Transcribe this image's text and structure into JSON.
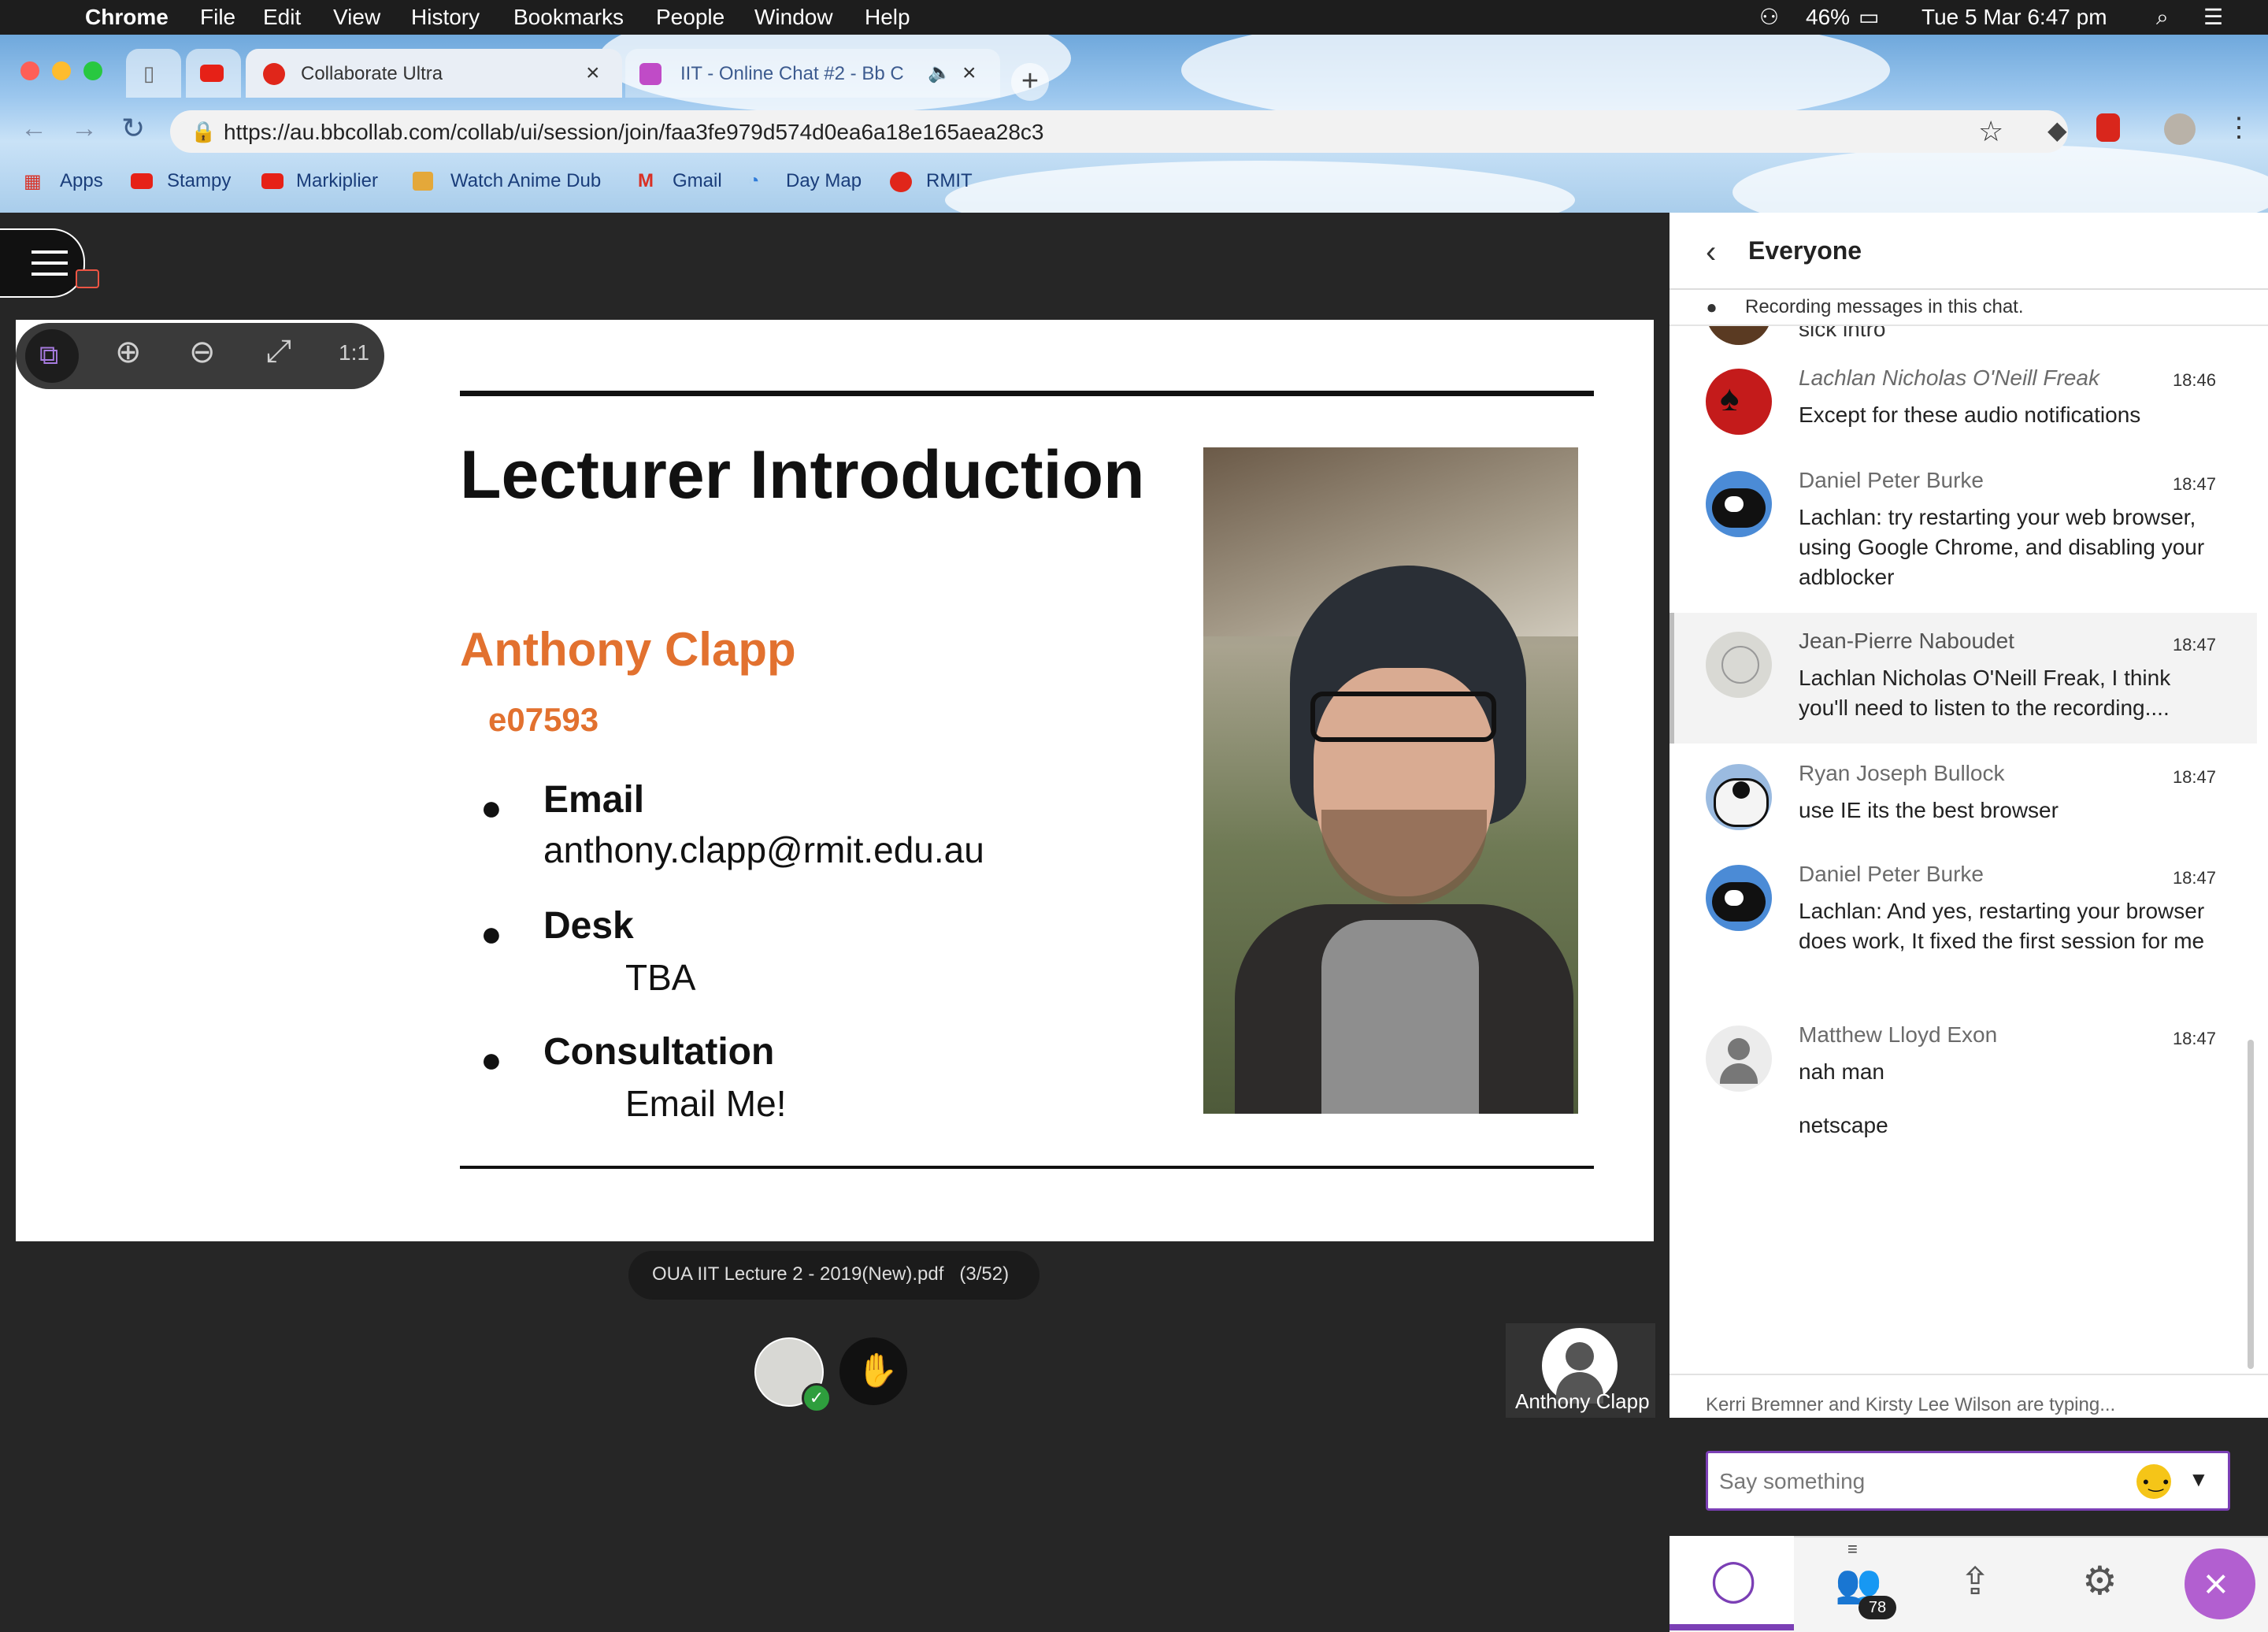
{
  "menubar": {
    "app": "Chrome",
    "items": [
      "File",
      "Edit",
      "View",
      "History",
      "Bookmarks",
      "People",
      "Window",
      "Help"
    ],
    "battery": "46%",
    "clock": "Tue 5 Mar  6:47 pm"
  },
  "browser": {
    "tabs": [
      {
        "title": "Collaborate Ultra",
        "active": true
      },
      {
        "title": "IIT - Online Chat #2 - Bb C",
        "active": false
      }
    ],
    "url": "https://au.bbcollab.com/collab/ui/session/join/faa3fe979d574d0ea6a18e165aea28c3",
    "url_host": "au.bbcollab.com",
    "bookmarks": [
      "Apps",
      "Stampy",
      "Markiplier",
      "Watch Anime Dub",
      "Gmail",
      "Day Map",
      "RMIT"
    ]
  },
  "slide": {
    "title": "Lecturer Introduction",
    "name": "Anthony Clapp",
    "id": "e07593",
    "items": [
      {
        "label": "Email",
        "value": "anthony.clapp@rmit.edu.au"
      },
      {
        "label": "Desk",
        "value": "TBA"
      },
      {
        "label": "Consultation",
        "value": "Email Me!"
      }
    ],
    "file_label": "OUA IIT Lecture 2 - 2019(New).pdf   (3/52)"
  },
  "presenter": {
    "name": "Anthony Clapp"
  },
  "chat": {
    "header": "Everyone",
    "recording_notice": "Recording messages in this chat.",
    "partial_top": "sick intro",
    "messages": [
      {
        "name": "Lachlan Nicholas O'Neill Freak",
        "time": "18:46",
        "text": "Except for these audio notifications",
        "italic": true
      },
      {
        "name": "Daniel Peter Burke",
        "time": "18:47",
        "text": "Lachlan: try restarting your web browser, using Google Chrome, and disabling your adblocker"
      },
      {
        "name": "Jean-Pierre Naboudet",
        "time": "18:47",
        "text": "Lachlan Nicholas O'Neill Freak, I think you'll need to listen to the recording....",
        "highlight": true
      },
      {
        "name": "Ryan Joseph Bullock",
        "time": "18:47",
        "text": "use IE its the best browser"
      },
      {
        "name": "Daniel Peter Burke",
        "time": "18:47",
        "text": "Lachlan: And yes, restarting your browser does work, It fixed the first session for me"
      },
      {
        "name": "Matthew Lloyd Exon",
        "time": "18:47",
        "text": "nah man"
      }
    ],
    "extra_line": "netscape",
    "typing": "Kerri Bremner and Kirsty Lee Wilson are typing...",
    "input_placeholder": "Say something",
    "participants_count": "78"
  },
  "colors": {
    "accent": "#7b3fb5",
    "name_orange": "#e2712f",
    "close_btn": "#b25fd0"
  }
}
